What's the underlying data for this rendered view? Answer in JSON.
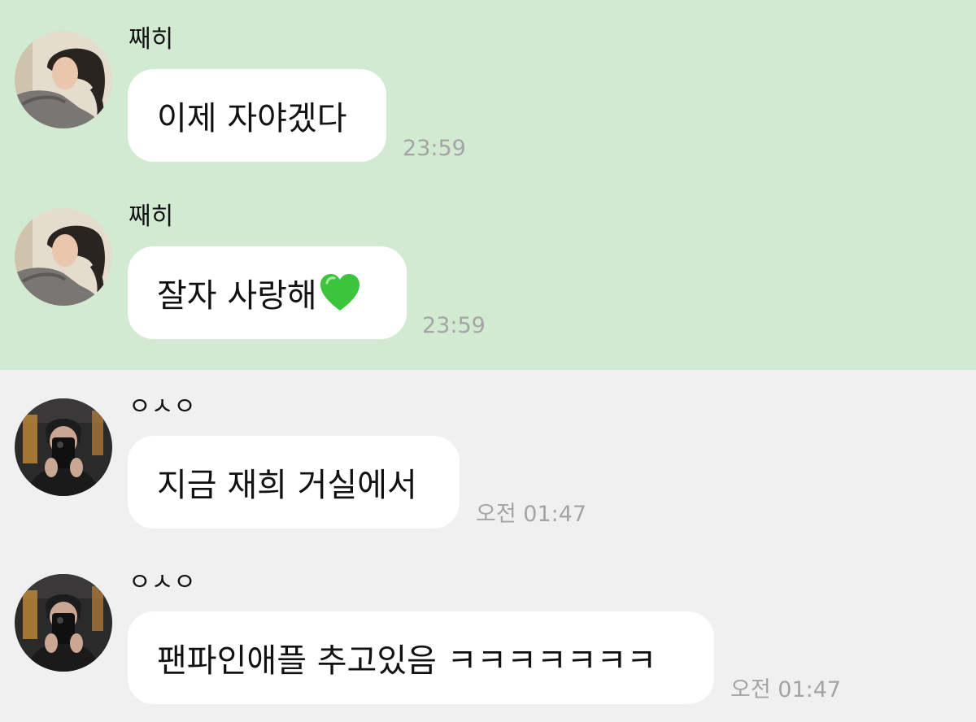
{
  "colors": {
    "highlight_background": "#d3ead2",
    "chat_background": "#f0f0f0",
    "bubble": "#ffffff",
    "timestamp": "#a4a4a4"
  },
  "messages": [
    {
      "sender": "째히",
      "text": "이제 자야겠다",
      "time": "23:59",
      "highlighted": true,
      "avatar": "sender-a-avatar"
    },
    {
      "sender": "째히",
      "text": "잘자 사랑해",
      "emoji": "green-heart-icon",
      "time": "23:59",
      "highlighted": true,
      "avatar": "sender-a-avatar"
    },
    {
      "sender": "ㅇㅅㅇ",
      "text": "지금 재희 거실에서",
      "time": "오전 01:47",
      "highlighted": false,
      "avatar": "sender-b-avatar"
    },
    {
      "sender": "ㅇㅅㅇ",
      "text": "팬파인애플 추고있음 ㅋㅋㅋㅋㅋㅋㅋ",
      "time": "오전 01:47",
      "highlighted": false,
      "avatar": "sender-b-avatar"
    }
  ]
}
